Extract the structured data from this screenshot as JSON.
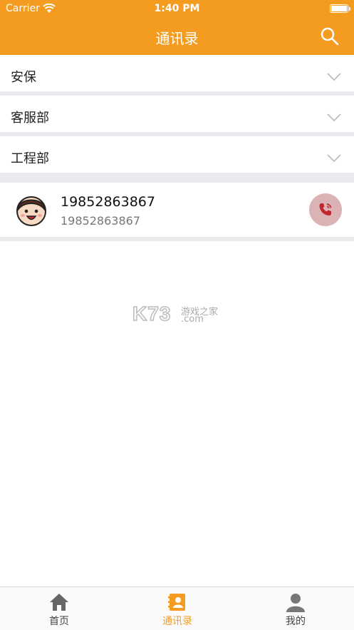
{
  "status_bar": {
    "carrier": "Carrier",
    "time": "1:40 PM"
  },
  "nav": {
    "title": "通讯录"
  },
  "groups": [
    {
      "label": "安保"
    },
    {
      "label": "客服部"
    },
    {
      "label": "工程部"
    }
  ],
  "contacts": [
    {
      "name": "19852863867",
      "phone": "19852863867"
    }
  ],
  "watermark": {
    "main": "K73",
    "cn": "游戏之家",
    "com": ".com"
  },
  "tabs": [
    {
      "label": "首页",
      "icon": "home-icon"
    },
    {
      "label": "通讯录",
      "icon": "contacts-icon"
    },
    {
      "label": "我的",
      "icon": "user-icon"
    }
  ],
  "colors": {
    "accent": "#f49c20",
    "call_button": "#dcb3b5",
    "call_icon": "#c0262c",
    "separator": "#e9e9ee"
  }
}
